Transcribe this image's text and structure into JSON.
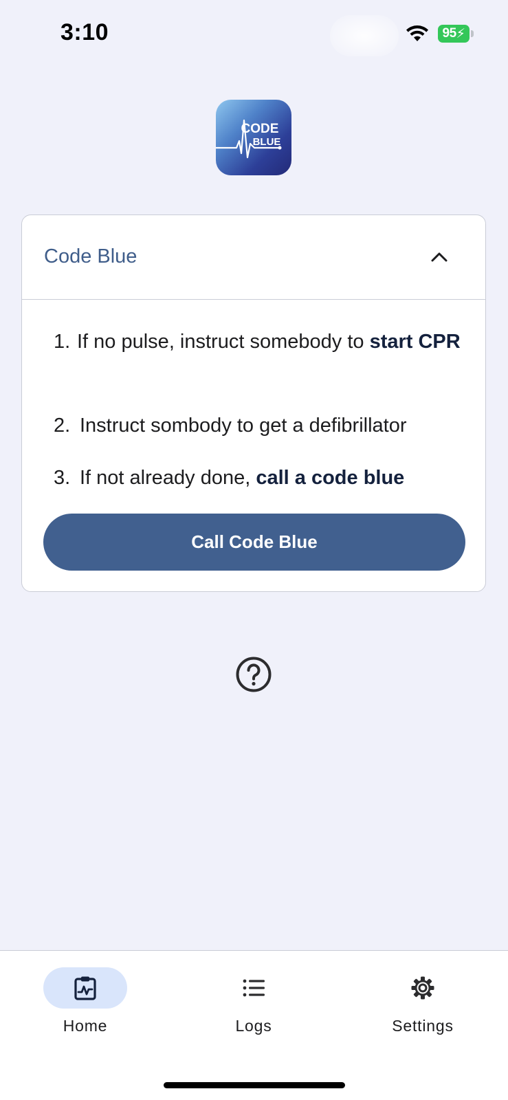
{
  "status_bar": {
    "time": "3:10",
    "battery_level": "95"
  },
  "app_logo": {
    "line1": "CODE",
    "line2": "BLUE"
  },
  "card": {
    "title": "Code Blue",
    "expanded": true,
    "steps": [
      {
        "number": "1.",
        "text": "If no pulse, instruct somebody to ",
        "bold": "start CPR"
      },
      {
        "number": "2.",
        "text": "Instruct sombody to get a defibrillator",
        "bold": ""
      },
      {
        "number": "3.",
        "text": "If not already done, ",
        "bold": "call a code blue"
      }
    ],
    "button_label": "Call Code Blue"
  },
  "tab_bar": {
    "tabs": [
      {
        "label": "Home",
        "icon": "clipboard-pulse-icon",
        "active": true
      },
      {
        "label": "Logs",
        "icon": "list-icon",
        "active": false
      },
      {
        "label": "Settings",
        "icon": "gear-icon",
        "active": false
      }
    ]
  },
  "colors": {
    "accent": "#41608f",
    "title": "#3f5d8a",
    "background": "#f0f1fa",
    "active_tab_pill": "#d9e5fb",
    "battery": "#34c759"
  }
}
